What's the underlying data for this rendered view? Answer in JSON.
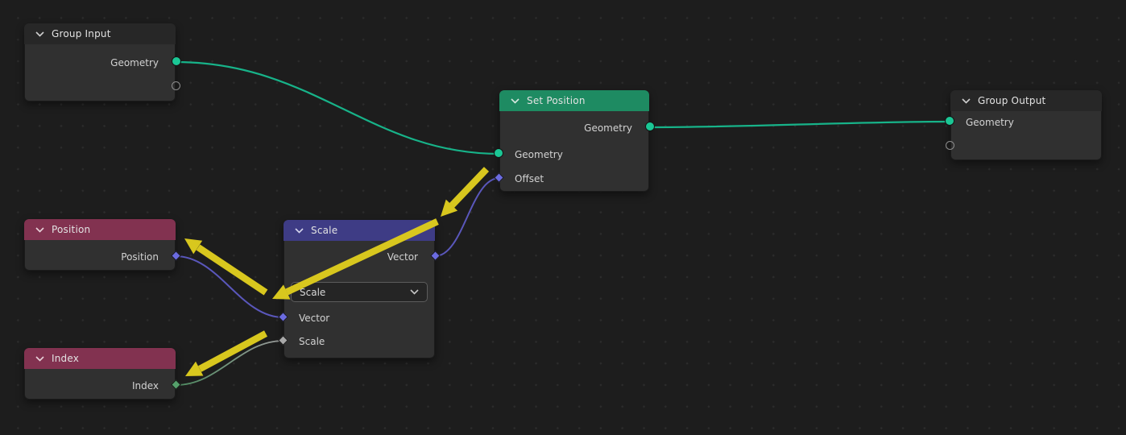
{
  "editor": {
    "name": "Geometry Node Editor"
  },
  "colors": {
    "background": "#1d1d1d",
    "grid_dot": "#2c2c2c",
    "node_body": "#303030",
    "header_default": "#272727",
    "header_geometry": "#1e8b62",
    "header_vector_math": "#3e3c85",
    "header_input": "#823250",
    "socket_geometry": "#1bc795",
    "socket_vector": "#6b6be0",
    "socket_int": "#55a06b",
    "socket_float": "#a8a8a8",
    "wire_geometry": "#17b389",
    "wire_vector": "#5a57bb",
    "wire_index_start": "#4e8c61",
    "wire_index_end": "#9b9b9b",
    "arrow": "#d8c71e"
  },
  "nodes": [
    {
      "id": "group-input",
      "title": "Group Input",
      "rows": [
        {
          "label": "Geometry",
          "side": "output",
          "socket": "geometry-circle"
        }
      ],
      "has_virtual_socket": true
    },
    {
      "id": "set-position",
      "title": "Set Position",
      "rows": [
        {
          "label": "Geometry",
          "side": "output",
          "socket": "geometry-circle"
        },
        {
          "label": "Geometry",
          "side": "input",
          "socket": "geometry-circle"
        },
        {
          "label": "Offset",
          "side": "input",
          "socket": "vector-diamond"
        }
      ]
    },
    {
      "id": "group-output",
      "title": "Group Output",
      "rows": [
        {
          "label": "Geometry",
          "side": "input",
          "socket": "geometry-circle"
        }
      ],
      "has_virtual_socket": true
    },
    {
      "id": "position",
      "title": "Position",
      "rows": [
        {
          "label": "Position",
          "side": "output",
          "socket": "vector-diamond"
        }
      ]
    },
    {
      "id": "scale",
      "title": "Scale",
      "dropdown": {
        "value": "Scale"
      },
      "rows": [
        {
          "label": "Vector",
          "side": "output",
          "socket": "vector-diamond"
        },
        {
          "label": "Vector",
          "side": "input",
          "socket": "vector-diamond"
        },
        {
          "label": "Scale",
          "side": "input",
          "socket": "float-diamond"
        }
      ]
    },
    {
      "id": "index",
      "title": "Index",
      "rows": [
        {
          "label": "Index",
          "side": "output",
          "socket": "int-diamond"
        }
      ]
    }
  ],
  "wires": [
    {
      "from": "group-input.Geometry",
      "to": "set-position.Geometry(in)",
      "type": "geometry"
    },
    {
      "from": "set-position.Geometry",
      "to": "group-output.Geometry",
      "type": "geometry"
    },
    {
      "from": "scale.Vector(out)",
      "to": "set-position.Offset",
      "type": "vector"
    },
    {
      "from": "position.Position",
      "to": "scale.Vector(in)",
      "type": "vector"
    },
    {
      "from": "index.Index",
      "to": "scale.Scale(in)",
      "type": "int-float"
    }
  ],
  "annotations": [
    {
      "id": "arrow-offset-to-scale-node",
      "points_at": "scale node header"
    },
    {
      "id": "arrow-scale-node-to-vector-input",
      "points_at": "scale vector input"
    },
    {
      "id": "arrow-vector-input-to-position-node",
      "points_at": "position node"
    },
    {
      "id": "arrow-scale-input-to-index-socket",
      "points_at": "index output socket"
    }
  ]
}
